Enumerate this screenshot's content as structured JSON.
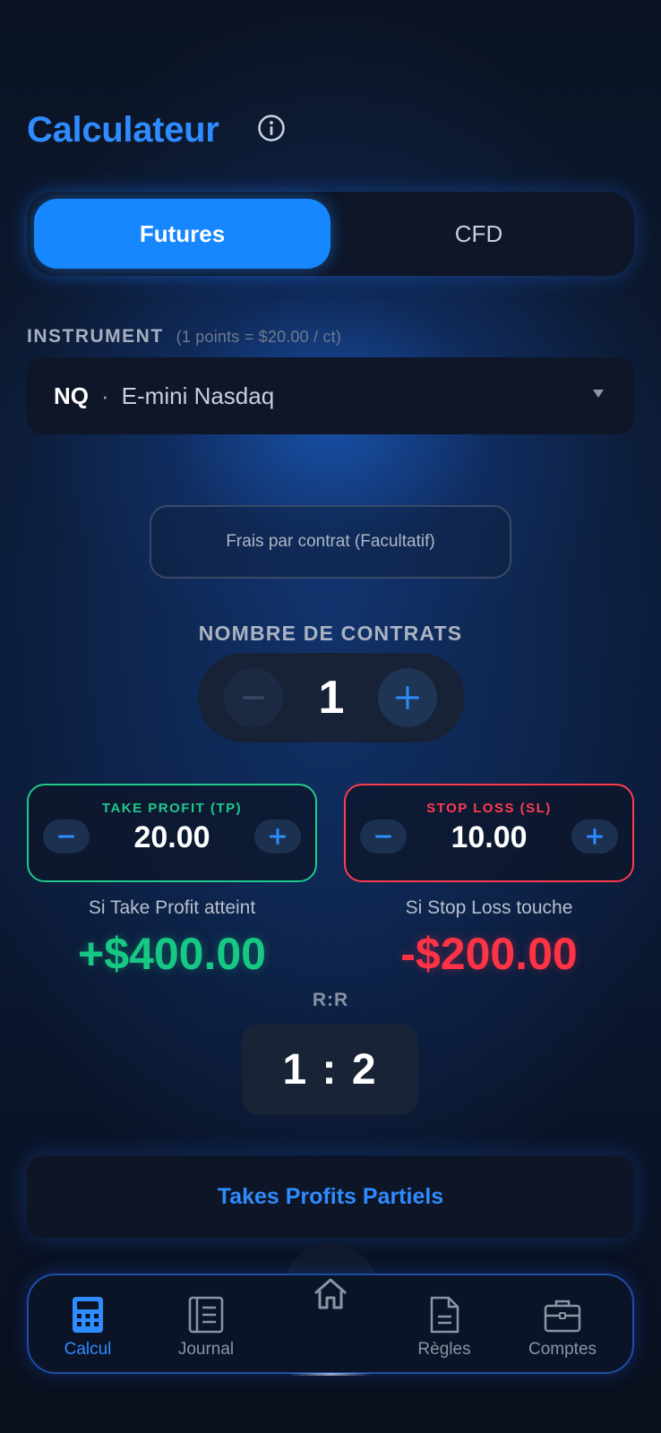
{
  "header": {
    "title": "Calculateur",
    "info_icon": "info-circle-icon"
  },
  "mode_toggle": {
    "options": [
      "Futures",
      "CFD"
    ],
    "selected": "Futures"
  },
  "instrument": {
    "label": "INSTRUMENT",
    "hint": "(1 points = $20.00 / ct)",
    "code": "NQ",
    "separator": "·",
    "name": "E-mini Nasdaq"
  },
  "fees": {
    "placeholder": "Frais par contrat (Facultatif)"
  },
  "contracts": {
    "label": "NOMBRE DE CONTRATS",
    "value": "1"
  },
  "take_profit": {
    "label": "TAKE PROFIT (TP)",
    "value": "20.00",
    "outcome_label": "Si Take Profit atteint",
    "outcome_value": "+$400.00"
  },
  "stop_loss": {
    "label": "STOP LOSS (SL)",
    "value": "10.00",
    "outcome_label": "Si Stop Loss touche",
    "outcome_value": "-$200.00"
  },
  "risk_reward": {
    "label": "R:R",
    "value": "1 : 2"
  },
  "partial_tp": {
    "label": "Takes Profits Partiels"
  },
  "nav": {
    "items": [
      {
        "label": "Calcul",
        "icon": "calculator-icon",
        "active": true
      },
      {
        "label": "Journal",
        "icon": "journal-icon",
        "active": false
      },
      {
        "label": "",
        "icon": "home-icon",
        "active": false
      },
      {
        "label": "Règles",
        "icon": "document-icon",
        "active": false
      },
      {
        "label": "Comptes",
        "icon": "briefcase-icon",
        "active": false
      }
    ]
  },
  "colors": {
    "accent": "#2f8cff",
    "profit": "#17c784",
    "loss": "#ff3346",
    "background": "#0b1120"
  }
}
